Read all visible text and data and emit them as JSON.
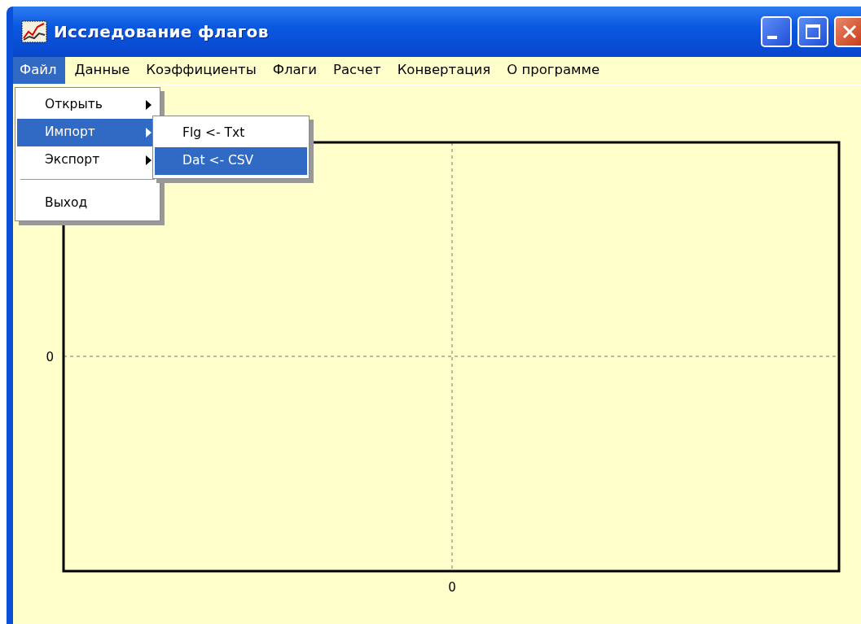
{
  "window": {
    "title": "Исследование флагов"
  },
  "menu_bar": [
    {
      "label": "Файл",
      "selected": true
    },
    {
      "label": "Данные",
      "selected": false
    },
    {
      "label": "Коэффициенты",
      "selected": false
    },
    {
      "label": "Флаги",
      "selected": false
    },
    {
      "label": "Расчет",
      "selected": false
    },
    {
      "label": "Конвертация",
      "selected": false
    },
    {
      "label": "О программе",
      "selected": false
    }
  ],
  "file_menu": [
    {
      "kind": "item",
      "label": "Открыть",
      "submenu": true,
      "selected": false
    },
    {
      "kind": "item",
      "label": "Импорт",
      "submenu": true,
      "selected": true
    },
    {
      "kind": "item",
      "label": "Экспорт",
      "submenu": true,
      "selected": false
    },
    {
      "kind": "separator"
    },
    {
      "kind": "item",
      "label": "Выход",
      "submenu": false,
      "selected": false
    }
  ],
  "import_submenu": [
    {
      "kind": "item",
      "label": "Flg <- Txt",
      "submenu": false,
      "selected": false
    },
    {
      "kind": "item",
      "label": "Dat <- CSV",
      "submenu": false,
      "selected": true
    }
  ],
  "plot": {
    "y_tick": "0",
    "x_tick": "0"
  }
}
